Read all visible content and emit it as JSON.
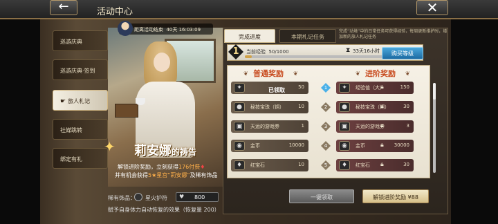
{
  "header": {
    "title": "活动中心",
    "back_icon": "arrow-left-icon",
    "close_icon": "close-icon"
  },
  "sidebar": {
    "items": [
      {
        "label": "巡游庆典",
        "active": false
      },
      {
        "label": "巡游庆典·签到",
        "active": false
      },
      {
        "label": "旅人札记",
        "active": true
      },
      {
        "label": "社媒跳转",
        "active": false
      },
      {
        "label": "绑定有礼",
        "active": false
      }
    ],
    "pointer_icon": "pointing-hand-icon"
  },
  "event": {
    "countdown_label": "距离活动结束",
    "countdown_value": "40天 16:03:09",
    "character_title_main": "莉安娜",
    "character_title_small": "的祷告",
    "unlock_text_1a": "解锁进阶奖励，立刻获得",
    "unlock_text_1b": "176付费",
    "unlock_text_2a": "并有机会获得",
    "unlock_text_2b": "5★星宫“莉安娜”",
    "unlock_text_2c": "及稀有饰品",
    "accessory_label": "稀有饰品：",
    "accessory_name": "星火护符",
    "heart_icon": "heart-icon",
    "heart_value": "800",
    "accessory_desc": "赋予自身体力自动恢复的效果（恢复量 200）"
  },
  "panel": {
    "tabs": [
      {
        "label": "完成进度",
        "active": true
      },
      {
        "label": "本期札记任务",
        "active": false
      }
    ],
    "note": "完成“动境”中的日常任务可获得经验，每周更新维护时，增加新的旅人札记任务",
    "level": "1",
    "exp_label": "当前经验",
    "exp_value": "50/1000",
    "exp_progress": 0.05,
    "hourglass_icon": "hourglass-icon",
    "time_left": "33天16小时",
    "buy_level_label": "购买等级",
    "head_normal": "普通奖励",
    "head_advanced": "进阶奖励",
    "claimed_label": "已领取",
    "rows": [
      {
        "level": "1",
        "normal_name": "经验值",
        "normal_qty": "50",
        "adv_name": "经验值（大）",
        "adv_qty": "150"
      },
      {
        "level": "2",
        "normal_name": "秘技宝珠（铜）",
        "normal_qty": "10",
        "adv_name": "秘技宝珠（铜）",
        "adv_qty": "30"
      },
      {
        "level": "3",
        "normal_name": "天运的游戏券",
        "normal_qty": "1",
        "adv_name": "天运的游戏券",
        "adv_qty": "3"
      },
      {
        "level": "4",
        "normal_name": "金币",
        "normal_qty": "10000",
        "adv_name": "金币",
        "adv_qty": "30000"
      },
      {
        "level": "5",
        "normal_name": "红宝石",
        "normal_qty": "10",
        "adv_name": "红宝石",
        "adv_qty": "30"
      }
    ],
    "claim_all_label": "一键领取",
    "unlock_adv_label": "解锁进阶奖励 ¥88"
  }
}
